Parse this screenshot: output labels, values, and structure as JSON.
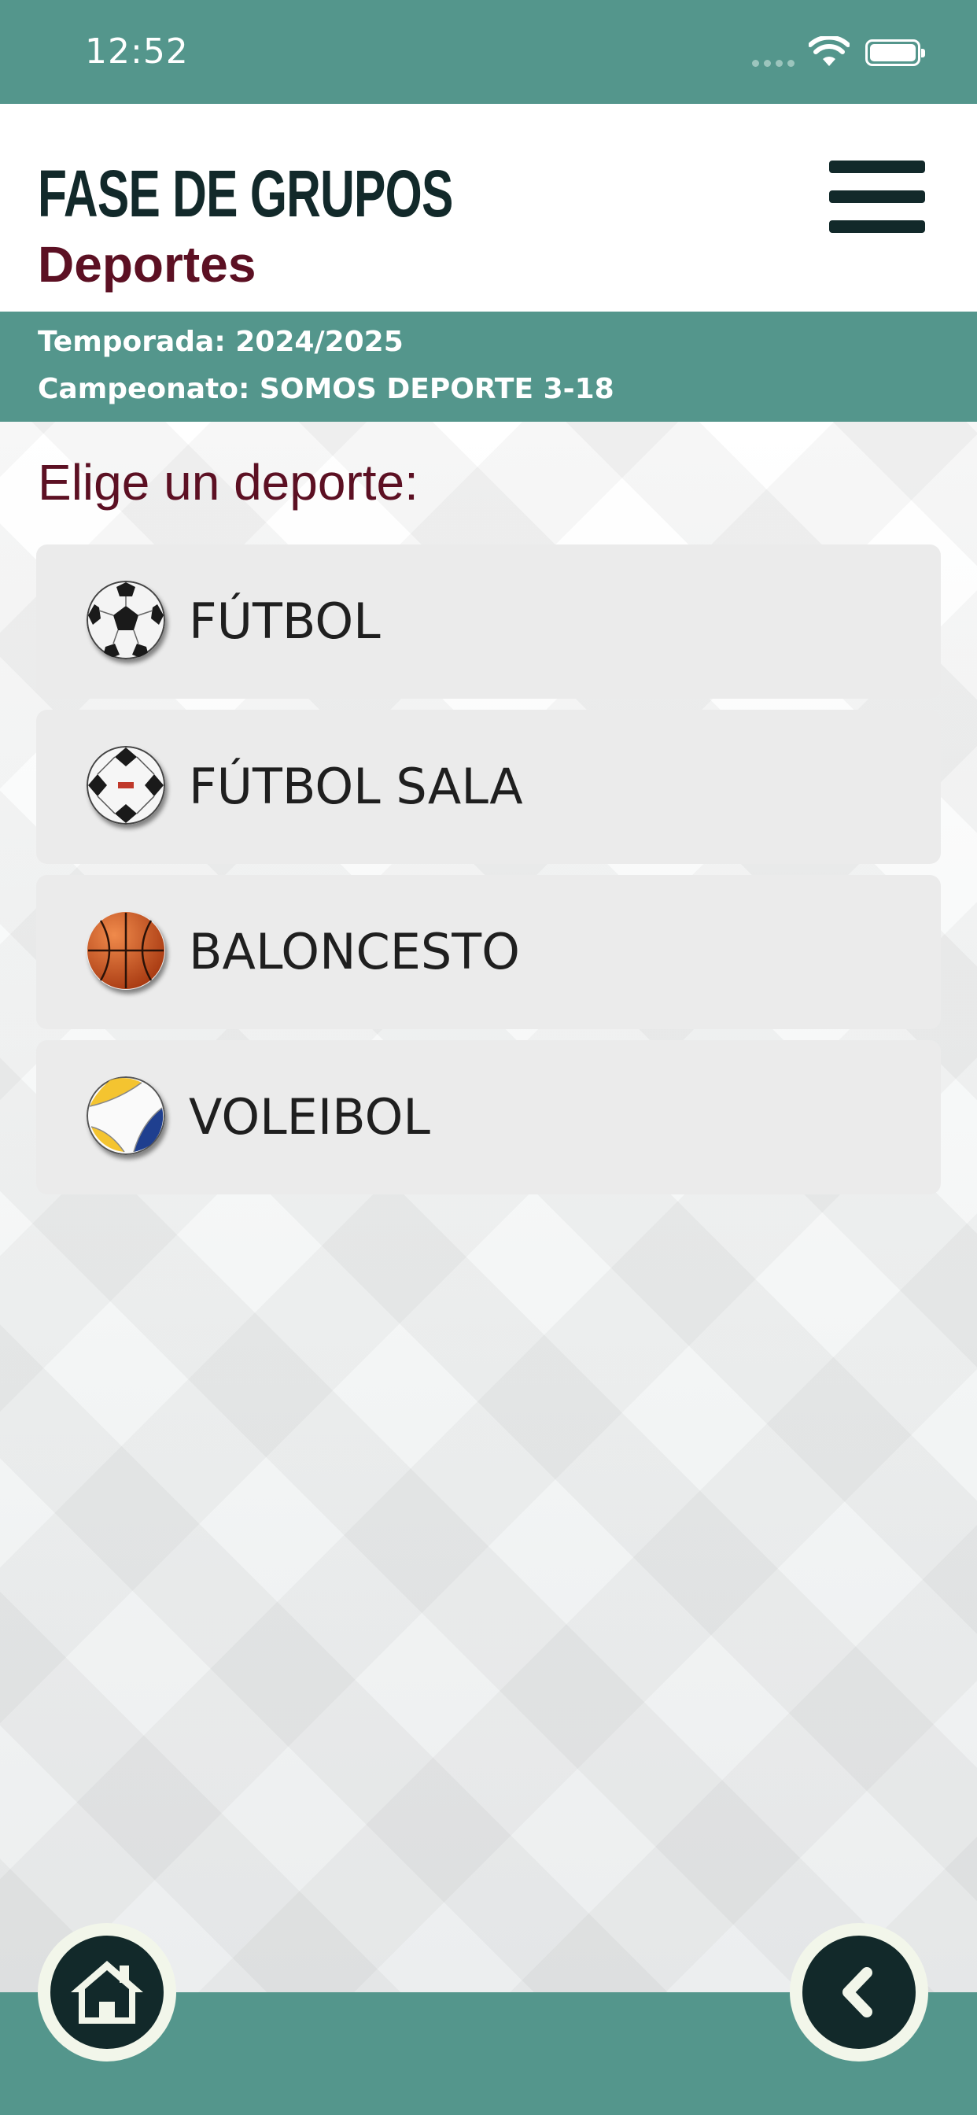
{
  "status_bar": {
    "time": "12:52",
    "icons": [
      "cellular-signal-icon",
      "wifi-icon",
      "battery-icon"
    ]
  },
  "header": {
    "title": "FASE DE GRUPOS",
    "subtitle": "Deportes",
    "menu_icon": "hamburger-menu-icon"
  },
  "info": {
    "season": "Temporada: 2024/2025",
    "championship": "Campeonato: SOMOS DEPORTE 3-18"
  },
  "main": {
    "prompt": "Elige un deporte:",
    "sports": [
      {
        "label": "FÚTBOL",
        "icon": "soccer-ball-icon"
      },
      {
        "label": "FÚTBOL SALA",
        "icon": "futsal-ball-icon"
      },
      {
        "label": "BALONCESTO",
        "icon": "basketball-icon"
      },
      {
        "label": "VOLEIBOL",
        "icon": "volleyball-icon"
      }
    ]
  },
  "bottom_nav": {
    "home_icon": "home-icon",
    "back_icon": "chevron-left-icon"
  },
  "colors": {
    "teal": "#54968c",
    "dark": "#12292a",
    "maroon": "#5c1023",
    "card": "#ebebeb"
  }
}
